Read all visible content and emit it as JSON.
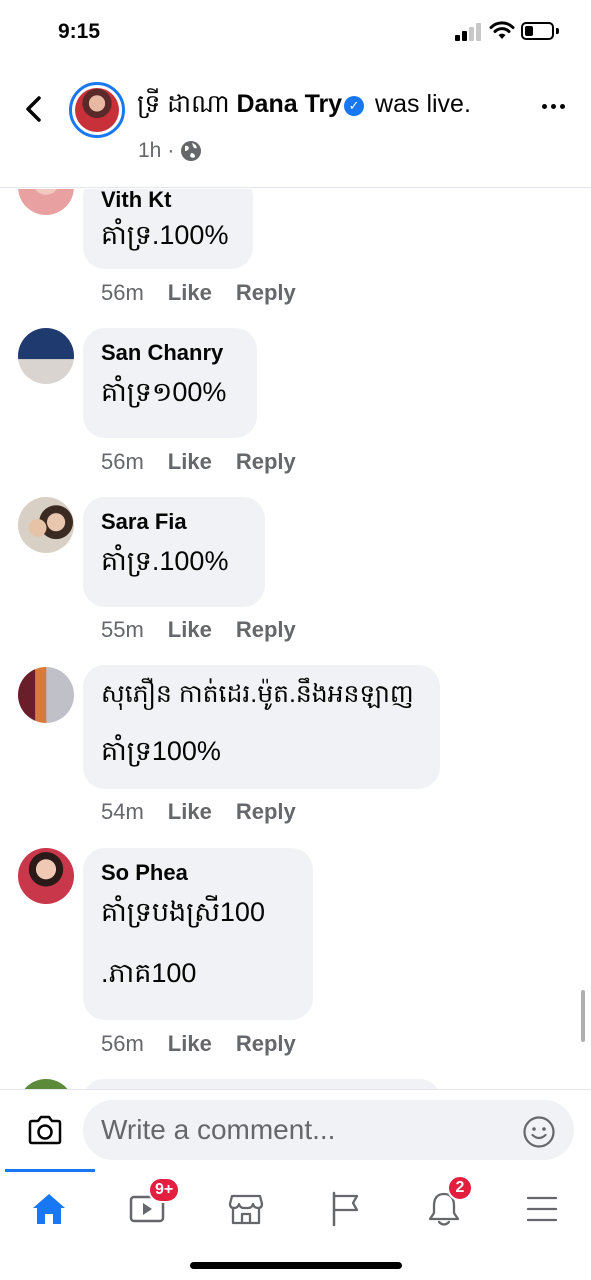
{
  "status_bar": {
    "time": "9:15"
  },
  "header": {
    "title_khmer": "ទ្រី ដាណា",
    "title_name": "Dana Try",
    "title_suffix": "was live.",
    "meta_time": "1h",
    "meta_sep": "·"
  },
  "comments": [
    {
      "author": "Vith Kt",
      "lines": [
        "គាំទ្រ.100%"
      ],
      "time": "56m",
      "like": "Like",
      "reply": "Reply"
    },
    {
      "author": "San Chanry",
      "lines": [
        "គាំទ្រ១00%"
      ],
      "time": "56m",
      "like": "Like",
      "reply": "Reply"
    },
    {
      "author": "Sara Fia",
      "lines": [
        "គាំទ្រ.100%"
      ],
      "time": "55m",
      "like": "Like",
      "reply": "Reply"
    },
    {
      "author": "",
      "lines": [
        "សុភឿន កាត់ដេរ.ម៉ូត.នឹងអនឡាញ",
        "គាំទ្រ100%"
      ],
      "time": "54m",
      "like": "Like",
      "reply": "Reply"
    },
    {
      "author": "So Phea",
      "lines": [
        "គាំទ្របងស្រី100",
        ".ភាគ100"
      ],
      "time": "56m",
      "like": "Like",
      "reply": "Reply"
    }
  ],
  "composer": {
    "placeholder": "Write a comment..."
  },
  "tabbar": {
    "watch_badge": "9+",
    "notifications_badge": "2"
  },
  "colors": {
    "accent": "#1877f2",
    "badge": "#e41e3f",
    "bubble": "#f0f2f5",
    "muted": "#65676b"
  }
}
